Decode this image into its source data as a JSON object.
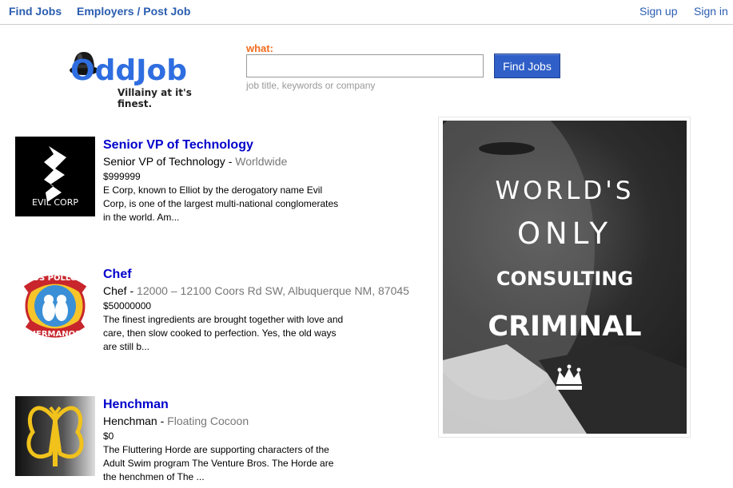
{
  "nav": {
    "find_jobs": "Find Jobs",
    "employers": "Employers / Post Job",
    "sign_up": "Sign up",
    "sign_in": "Sign in"
  },
  "logo": {
    "wordmark": "OddJob",
    "tagline": "Villainy at it's finest."
  },
  "search": {
    "label": "what:",
    "value": "",
    "placeholder": "",
    "hint": "job title, keywords or company",
    "button": "Find Jobs"
  },
  "jobs": [
    {
      "title": "Senior VP of Technology",
      "role": "Senior VP of Technology",
      "location": "Worldwide",
      "salary": "$999999",
      "description": "E Corp, known to Elliot by the derogatory name Evil Corp, is one of the largest multi-national conglomerates in the world. Am...",
      "logo_text": "EVIL CORP"
    },
    {
      "title": "Chef",
      "role": "Chef",
      "location": "12000 – 12100 Coors Rd SW, Albuquerque NM, 87045",
      "salary": "$50000000",
      "description": "The finest ingredients are brought together with love and care, then slow cooked to perfection. Yes, the old ways are still b...",
      "logo_text_top": "LOS POLLOS",
      "logo_text_bottom": "HERMANOS"
    },
    {
      "title": "Henchman",
      "role": "Henchman",
      "location": "Floating Cocoon",
      "salary": "$0",
      "description": "The Fluttering Horde are supporting characters of the Adult Swim program The Venture Bros. The Horde are the henchmen of The ..."
    }
  ],
  "ad": {
    "line1": "WORLD'S",
    "line2": "ONLY",
    "line3": "CONSULTING",
    "line4": "CRIMINAL"
  },
  "colors": {
    "link_blue": "#2a5db0",
    "title_blue": "#0000cc",
    "accent_orange": "#f26b1d",
    "button_blue": "#2f5fc7",
    "logo_blue": "#2f6ee0"
  }
}
